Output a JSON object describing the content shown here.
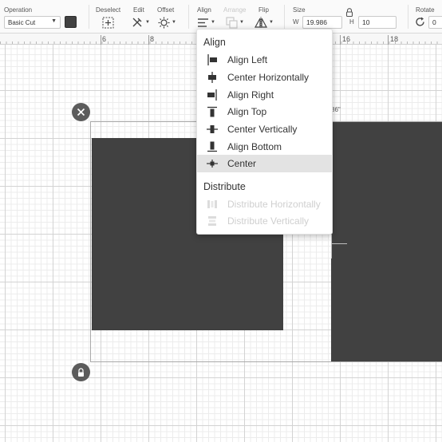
{
  "toolbar": {
    "operation_label": "Operation",
    "operation_value": "Basic Cut",
    "operation_color": "#414141",
    "deselect_label": "Deselect",
    "edit_label": "Edit",
    "offset_label": "Offset",
    "align_label": "Align",
    "arrange_label": "Arrange",
    "flip_label": "Flip",
    "size_label": "Size",
    "width_letter": "W",
    "width_value": "19.986",
    "height_letter": "H",
    "height_value": "10",
    "rotate_label": "Rotate",
    "rotate_value": "0"
  },
  "ruler": {
    "marks": [
      "6",
      "8",
      "16",
      "18"
    ]
  },
  "canvas": {
    "dimension_label": "86\""
  },
  "align_menu": {
    "align_header": "Align",
    "items": [
      {
        "label": "Align Left",
        "icon": "align-left-icon"
      },
      {
        "label": "Center Horizontally",
        "icon": "center-horizontally-icon"
      },
      {
        "label": "Align Right",
        "icon": "align-right-icon"
      },
      {
        "label": "Align Top",
        "icon": "align-top-icon"
      },
      {
        "label": "Center Vertically",
        "icon": "center-vertically-icon"
      },
      {
        "label": "Align Bottom",
        "icon": "align-bottom-icon"
      },
      {
        "label": "Center",
        "icon": "center-icon",
        "active": true
      }
    ],
    "distribute_header": "Distribute",
    "distribute_items": [
      {
        "label": "Distribute Horizontally",
        "icon": "distribute-horizontally-icon",
        "disabled": true
      },
      {
        "label": "Distribute Vertically",
        "icon": "distribute-vertically-icon",
        "disabled": true
      }
    ]
  },
  "colors": {
    "shape_fill": "#414141",
    "selected_item_bg": "#e3e3e3",
    "disabled_text": "#cfcfcf"
  }
}
